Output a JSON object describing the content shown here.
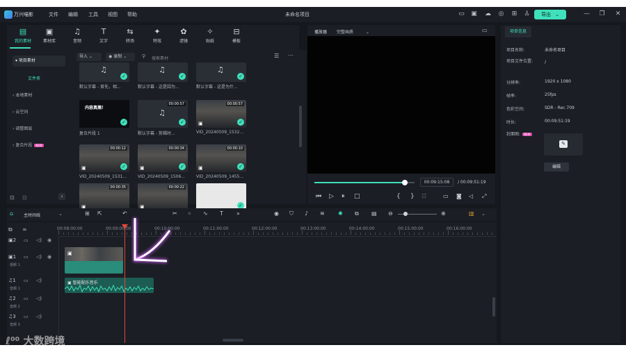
{
  "app": {
    "name": "万兴喵影",
    "doc_title": "未命名项目",
    "menu": [
      "文件",
      "编辑",
      "工具",
      "视图",
      "帮助"
    ],
    "export_label": "导出"
  },
  "tools": [
    {
      "label": "我的素材",
      "icon": "folder-icon"
    },
    {
      "label": "素材库",
      "icon": "library-icon"
    },
    {
      "label": "音频",
      "icon": "music-icon"
    },
    {
      "label": "文字",
      "icon": "text-icon"
    },
    {
      "label": "转场",
      "icon": "transition-icon"
    },
    {
      "label": "特效",
      "icon": "effects-icon"
    },
    {
      "label": "滤镜",
      "icon": "filter-icon"
    },
    {
      "label": "贴纸",
      "icon": "sticker-icon"
    },
    {
      "label": "模板",
      "icon": "template-icon"
    }
  ],
  "sidebar": {
    "items": [
      {
        "label": "项目素材"
      },
      {
        "label": "文件夹"
      },
      {
        "label": "本地素材"
      },
      {
        "label": "云空间"
      },
      {
        "label": "调整图层"
      },
      {
        "label": "复合片段",
        "badge": "NEW"
      }
    ]
  },
  "media": {
    "import_label": "导入",
    "record_label": "录制",
    "search_placeholder": "搜索素材",
    "items": [
      {
        "caption": "默认字幕 - 首先，相...",
        "duration": "",
        "type": "audio"
      },
      {
        "caption": "默认字幕 - 这是因为...",
        "duration": "",
        "type": "audio"
      },
      {
        "caption": "默认字幕 - 这是为什...",
        "duration": "",
        "type": "audio"
      },
      {
        "caption": "复合片段 1",
        "duration": "",
        "type": "black",
        "text": "内容真摘！"
      },
      {
        "caption": "默认字幕 - 剪辑时...",
        "duration": "00:00:57",
        "type": "audio"
      },
      {
        "caption": "VID_20240509_1532...",
        "duration": "00:00:57",
        "type": "vid"
      },
      {
        "caption": "VID_20240509_1531...",
        "duration": "00:00:12",
        "type": "vid"
      },
      {
        "caption": "VID_20240509_1506...",
        "duration": "00:00:34",
        "type": "vid"
      },
      {
        "caption": "VID_20240509_1455...",
        "duration": "00:00:10",
        "type": "vid"
      },
      {
        "caption": "",
        "duration": "00:00:35",
        "type": "vid"
      },
      {
        "caption": "",
        "duration": "00:00:22",
        "type": "vid"
      },
      {
        "caption": "",
        "duration": "",
        "type": "grid"
      }
    ]
  },
  "player": {
    "tab_label": "播放器",
    "quality_label": "完整画质",
    "current_time": "00:09:15:08",
    "total_time": "/ 00:09:51:19",
    "progress": 0.9
  },
  "props": {
    "tab_label": "项目信息",
    "rows": [
      {
        "label": "项目名称:",
        "value": "未命名项目"
      },
      {
        "label": "项目文件位置:",
        "value": "/"
      },
      {
        "label": "分辨率:",
        "value": "1920 x 1080"
      },
      {
        "label": "帧率:",
        "value": "25fps"
      },
      {
        "label": "色彩空间:",
        "value": "SDR - Rec.709"
      },
      {
        "label": "时长:",
        "value": "00:09:51:19"
      }
    ],
    "cover_label": "封面图:",
    "cover_badge": "NEW",
    "edit_label": "编辑"
  },
  "timeline": {
    "track_label": "主时间线",
    "ruler": [
      "00:08:00:00",
      "00:09:00:00",
      "00:10:00:00",
      "00:11:00:00",
      "00:12:00:00",
      "00:13:00:00",
      "00:14:00:00",
      "00:15:00:00",
      "00:16:00:00"
    ],
    "tracks": [
      {
        "num": "2",
        "name": ""
      },
      {
        "num": "1",
        "name": "视频 1"
      },
      {
        "num": "1",
        "name": "音频 1"
      },
      {
        "num": "2",
        "name": "音频 2"
      },
      {
        "num": "3",
        "name": "音频 3"
      }
    ],
    "audio_clip_label": "智能配乐音乐"
  },
  "watermark": "大数跨境",
  "colors": {
    "accent": "#3fe0bb",
    "playhead": "#e0473a",
    "background": "#15181d",
    "panel": "#1b1e24"
  }
}
